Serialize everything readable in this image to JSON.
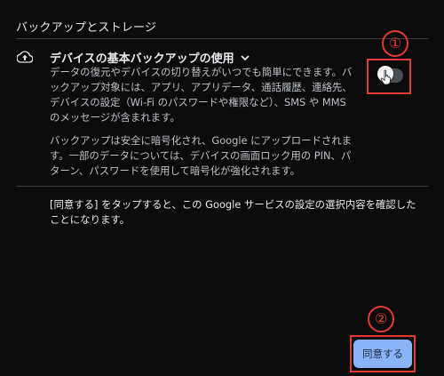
{
  "section": {
    "title": "バックアップとストレージ"
  },
  "backup": {
    "icon": "cloud-upload-icon",
    "title": "デバイスの基本バックアップの使用",
    "expand_icon": "chevron-down-icon",
    "description_1": "データの復元やデバイスの切り替えがいつでも簡単にできます。バックアップ対象には、アプリ、アプリデータ、通話履歴、連絡先、デバイスの設定（Wi-Fi のパスワードや権限など）、SMS や MMS のメッセージが含まれます。",
    "description_2": "バックアップは安全に暗号化され、Google にアップロードされます。一部のデータについては、デバイスの画面ロック用の PIN、パターン、パスワードを使用して暗号化が強化されます。",
    "toggle_on": false
  },
  "consent": {
    "text": "[同意する] をタップすると、この Google サービスの設定の選択内容を確認したことになります。"
  },
  "actions": {
    "agree_label": "同意する"
  },
  "annotations": {
    "step1": "①",
    "step2": "②",
    "color": "#e53935"
  },
  "colors": {
    "background": "#0b0b0c",
    "accent_button": "#8ab4f8",
    "text_primary": "#e8eaed",
    "text_secondary": "#bdc1c6"
  }
}
